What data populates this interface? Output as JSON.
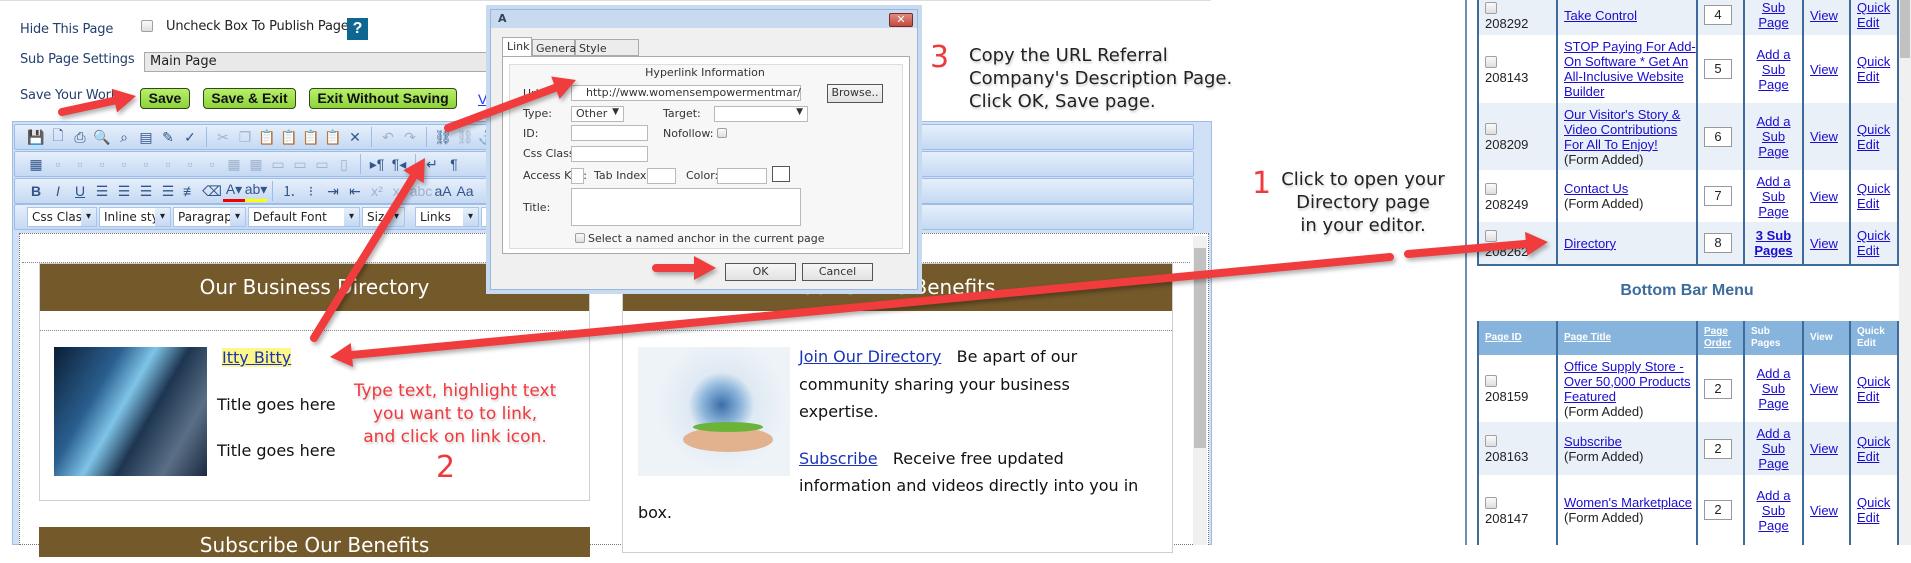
{
  "settings": {
    "hide_label": "Hide This Page",
    "uncheck_label": "Uncheck Box To Publish Page",
    "help": "?",
    "subpage_label": "Sub Page Settings",
    "subpage_value": "Main Page",
    "save_label": "Save Your Work",
    "save": "Save",
    "save_exit": "Save & Exit",
    "exit_nosave": "Exit Without Saving",
    "view_link": "Vi"
  },
  "toolbar": {
    "row1": [
      "save-icon",
      "new-document-icon",
      "print-icon",
      "preview-icon",
      "find-icon",
      "template-icon",
      "clean-icon",
      "spellcheck-icon",
      "|",
      "cut-icon",
      "copy-icon",
      "paste-icon",
      "paste-text-icon",
      "paste-word-icon",
      "paste-html-icon",
      "delete-icon",
      "|",
      "undo-icon",
      "redo-icon",
      "|",
      "link-icon",
      "unlink-icon",
      "anchor-icon"
    ],
    "row2": [
      "table-icon",
      "insert-col-left-icon",
      "insert-col-right-icon",
      "insert-row-icon",
      "insert-row-above-icon",
      "insert-row-below-icon",
      "delete-row-icon",
      "merge-left-icon",
      "merge-right-icon",
      "grid-icon",
      "grid2-icon",
      "cell-props-icon",
      "table-props-icon",
      "split-icon",
      "split-vert-icon",
      "|",
      "ltr-icon",
      "rtl-icon",
      "|",
      "break-icon",
      "paragraph-icon"
    ],
    "row3": [
      "bold-icon",
      "italic-icon",
      "underline-icon",
      "align-left-icon",
      "align-center-icon",
      "align-right-icon",
      "justify-icon",
      "strike-lines-icon",
      "eraser-icon",
      "font-color-icon",
      "highlight-icon",
      "|",
      "ordered-list-icon",
      "unordered-list-icon",
      "indent-icon",
      "outdent-icon",
      "superscript-icon",
      "subscript-icon",
      "strikethrough-icon",
      "lowercase-icon",
      "uppercase-icon"
    ],
    "dropdowns": [
      "Css Class",
      "Inline style",
      "Paragraph",
      "Default Font",
      "Size",
      "Links",
      "C"
    ]
  },
  "editor": {
    "left_box": {
      "title": "Our Business Directory",
      "link": "Itty Bitty",
      "line1": "Title goes here",
      "line2": "Title goes here"
    },
    "right_box": {
      "title": "Our Online Benefits",
      "link1": "Join Our Directory",
      "text1a": "Be apart of our",
      "text1b": "community sharing your business",
      "text1c": "expertise.",
      "link2": "Subscribe",
      "text2a": "Receive free updated",
      "text2b": "information and videos directly into you in",
      "text2c": "box."
    },
    "next_box_title": "Subscribe Our Benefits"
  },
  "dialog": {
    "title": "A",
    "tabs": [
      "Link",
      "General",
      "Style Builder"
    ],
    "group": "Hyperlink Information",
    "url_label": "Url:",
    "url_value": "http://www.womensempowermentmar/",
    "browse": "Browse..",
    "type_label": "Type:",
    "type_value": "Other",
    "target_label": "Target:",
    "id_label": "ID:",
    "nofollow_label": "Nofollow:",
    "css_label": "Css Class:",
    "access_label": "Access Key:",
    "tab_label": "Tab Index:",
    "color_label": "Color:",
    "title_label": "Title:",
    "anchor_label": "Select a named anchor in the current page",
    "ok": "OK",
    "cancel": "Cancel"
  },
  "annotations": {
    "step1_num": "1",
    "step1": [
      "Click to open your",
      "Directory page",
      "in your editor."
    ],
    "step2_num": "2",
    "step2": [
      "Type text, highlight text",
      "you want to to link,",
      "and click on link icon."
    ],
    "step3_num": "3",
    "step3": [
      "Copy the URL Referral",
      "Company's Description Page.",
      "Click OK, Save page."
    ],
    "arrow_color": "#f03c3c"
  },
  "top_menu": {
    "rows": [
      {
        "id": "208292",
        "title": "Take Control",
        "note": "",
        "order": "4",
        "sub": "Sub Page",
        "sub_bold": false
      },
      {
        "id": "208143",
        "title": "STOP Paying For Add-On Software * Get An All-Inclusive Website Builder",
        "note": "",
        "order": "5",
        "sub": "Add a Sub Page",
        "sub_bold": false
      },
      {
        "id": "208209",
        "title": "Our Visitor's Story & Video Contributions For All To Enjoy!",
        "note": "(Form Added)",
        "order": "6",
        "sub": "Add a Sub Page",
        "sub_bold": false
      },
      {
        "id": "208249",
        "title": "Contact Us",
        "note": "(Form Added)",
        "order": "7",
        "sub": "Add a Sub Page",
        "sub_bold": false
      },
      {
        "id": "208262",
        "title": "Directory",
        "note": "",
        "order": "8",
        "sub": "3 Sub Pages",
        "sub_bold": true
      }
    ],
    "view": "View",
    "quick": "Quick Edit"
  },
  "bottom_menu": {
    "heading": "Bottom Bar Menu",
    "headers": [
      "Page ID",
      "Page Title",
      "Page Order",
      "Sub Pages",
      "View",
      "Quick Edit"
    ],
    "rows": [
      {
        "id": "208159",
        "title": "Office Supply Store - Over 50,000 Products Featured",
        "note": "(Form Added)",
        "order": "2",
        "sub": "Add a Sub Page"
      },
      {
        "id": "208163",
        "title": "Subscribe",
        "note": "(Form Added)",
        "order": "2",
        "sub": "Add a Sub Page"
      },
      {
        "id": "208147",
        "title": "Women's Marketplace",
        "note": "(Form Added)",
        "order": "2",
        "sub": "Add a Sub Page"
      }
    ],
    "view": "View",
    "quick": "Quick Edit"
  }
}
